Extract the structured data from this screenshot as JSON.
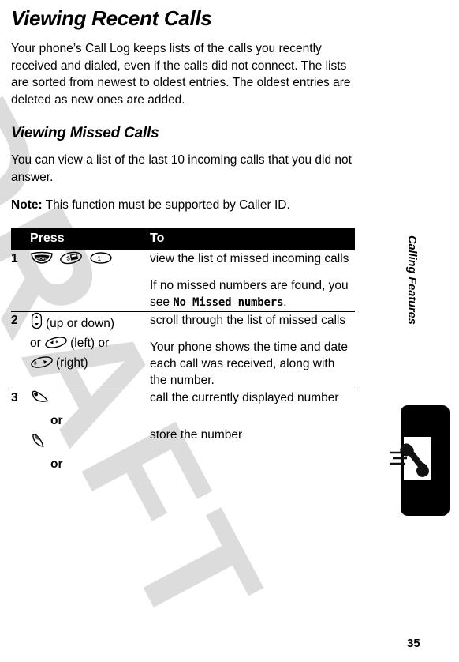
{
  "page": {
    "title": "Viewing Recent Calls",
    "number": "35",
    "watermark": "DRAFT",
    "running_head": "Calling Features"
  },
  "intro": {
    "paragraph": "Your phone’s Call Log keeps lists of the calls you recently received and dialed, even if the calls did not connect. The lists are sorted from newest to oldest entries. The oldest entries are deleted as new ones are added."
  },
  "section": {
    "heading": "Viewing Missed Calls",
    "paragraph": "You can view a list of the last 10 incoming calls that you did not answer.",
    "note_label": "Note:",
    "note_text": " This function must be supported by Caller ID."
  },
  "table": {
    "headers": {
      "number": "",
      "press": "Press",
      "to": "To"
    },
    "rows": [
      {
        "number": "1",
        "press": {
          "keys": [
            "menu-key",
            "three-key",
            "one-key"
          ],
          "text": ""
        },
        "to": [
          {
            "text": "view the list of missed incoming calls"
          },
          {
            "prefix": "If no missed numbers are found, you see ",
            "device_text": "No Missed numbers",
            "suffix": "."
          }
        ]
      },
      {
        "number": "2",
        "press": {
          "lines": [
            {
              "key": "nav-key",
              "label": "(up or down)"
            },
            {
              "prefix": "or ",
              "key": "star-key",
              "label": "(left) or"
            },
            {
              "key": "pound-key",
              "label": "(right)"
            }
          ]
        },
        "to": [
          {
            "text": "scroll through the list of missed calls"
          },
          {
            "text": "Your phone shows the time and date each call was received, along with the number."
          }
        ]
      },
      {
        "number": "3",
        "press": {
          "lines": [
            {
              "key": "send-key",
              "label": ""
            },
            {
              "or": "or"
            },
            {
              "key": "store-key",
              "label": ""
            },
            {
              "or": "or"
            }
          ]
        },
        "to": [
          {
            "text": "call the currently displayed number"
          },
          {
            "text": ""
          },
          {
            "text": "store the number"
          }
        ]
      }
    ],
    "or_label": "or"
  },
  "colors": {
    "header_bar": "#000000",
    "header_text": "#ffffff",
    "watermark": "#dcdcdc",
    "rule": "#000000"
  }
}
